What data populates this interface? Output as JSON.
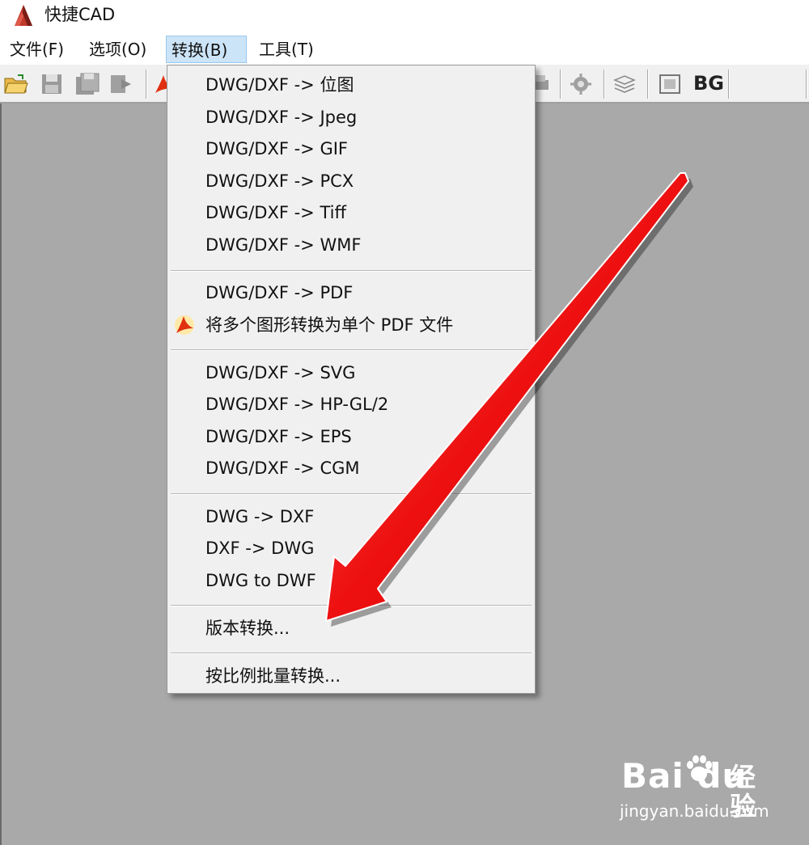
{
  "app": {
    "title": "快捷CAD"
  },
  "menubar": {
    "items": [
      {
        "label": "文件(F)"
      },
      {
        "label": "选项(O)"
      },
      {
        "label": "转换(B)"
      },
      {
        "label": "工具(T)"
      }
    ]
  },
  "toolbar": {
    "bg_label": "BG"
  },
  "dropdown": {
    "items": [
      "DWG/DXF -> 位图",
      "DWG/DXF -> Jpeg",
      "DWG/DXF -> GIF",
      "DWG/DXF -> PCX",
      "DWG/DXF -> Tiff",
      "DWG/DXF -> WMF",
      "DWG/DXF -> PDF",
      "将多个图形转换为单个 PDF 文件",
      "DWG/DXF -> SVG",
      "DWG/DXF -> HP-GL/2",
      "DWG/DXF -> EPS",
      "DWG/DXF -> CGM",
      "DWG -> DXF",
      "DXF -> DWG",
      "DWG to DWF",
      "版本转换...",
      "按比例批量转换..."
    ]
  },
  "watermark": {
    "logo": "Bai du",
    "brand": "经验",
    "url": "jingyan.baidu.com"
  },
  "colors": {
    "workspace": "#a9a9a9",
    "menu_active": "#cce4f7",
    "arrow": "#e60000"
  }
}
